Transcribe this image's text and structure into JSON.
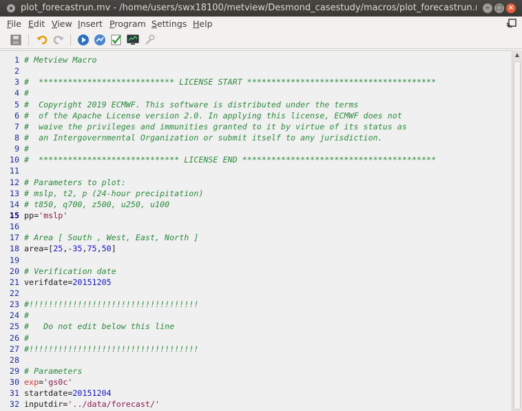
{
  "window": {
    "title": "plot_forecastrun.mv - /home/users/swx18100/metview/Desmond_casestudy/macros/plot_forecastrun.mv"
  },
  "menu": {
    "items": [
      {
        "mnemonic": "F",
        "rest": "ile"
      },
      {
        "mnemonic": "E",
        "rest": "dit"
      },
      {
        "mnemonic": "V",
        "rest": "iew"
      },
      {
        "mnemonic": "I",
        "rest": "nsert"
      },
      {
        "mnemonic": "P",
        "rest": "rogram"
      },
      {
        "mnemonic": "S",
        "rest": "ettings"
      },
      {
        "mnemonic": "H",
        "rest": "elp"
      }
    ]
  },
  "toolbar": {
    "icons": [
      "save-icon",
      "undo-icon",
      "redo-icon",
      "run-icon",
      "visualise-icon",
      "check-icon",
      "monitor-icon",
      "tools-icon"
    ]
  },
  "colors": {
    "comment": "#2b8a3c",
    "number": "#1313c0",
    "string": "#8a1a4a",
    "keyword": "#d03a3a",
    "line_number": "#1a2a9a"
  },
  "editor": {
    "current_line": 15,
    "lines": [
      {
        "n": "1",
        "tokens": [
          {
            "t": "# Metview Macro",
            "c": "comment"
          }
        ]
      },
      {
        "n": "2",
        "tokens": []
      },
      {
        "n": "3",
        "tokens": [
          {
            "t": "#  **************************** LICENSE START ***************************************",
            "c": "comment"
          }
        ]
      },
      {
        "n": "4",
        "tokens": [
          {
            "t": "#",
            "c": "comment"
          }
        ]
      },
      {
        "n": "5",
        "tokens": [
          {
            "t": "#  Copyright 2019 ECMWF. This software is distributed under the terms",
            "c": "comment"
          }
        ]
      },
      {
        "n": "6",
        "tokens": [
          {
            "t": "#  of the Apache License version 2.0. In applying this license, ECMWF does not",
            "c": "comment"
          }
        ]
      },
      {
        "n": "7",
        "tokens": [
          {
            "t": "#  waive the privileges and immunities granted to it by virtue of its status as",
            "c": "comment"
          }
        ]
      },
      {
        "n": "8",
        "tokens": [
          {
            "t": "#  an Intergovernmental Organization or submit itself to any jurisdiction.",
            "c": "comment"
          }
        ]
      },
      {
        "n": "9",
        "tokens": [
          {
            "t": "#",
            "c": "comment"
          }
        ]
      },
      {
        "n": "10",
        "tokens": [
          {
            "t": "#  ***************************** LICENSE END ****************************************",
            "c": "comment"
          }
        ]
      },
      {
        "n": "11",
        "tokens": []
      },
      {
        "n": "12",
        "tokens": [
          {
            "t": "# Parameters to plot:",
            "c": "comment"
          }
        ]
      },
      {
        "n": "13",
        "tokens": [
          {
            "t": "# mslp, t2, p (24-hour precipitation)",
            "c": "comment"
          }
        ]
      },
      {
        "n": "14",
        "tokens": [
          {
            "t": "# t850, q700, z500, u250, u100",
            "c": "comment"
          }
        ]
      },
      {
        "n": "15",
        "tokens": [
          {
            "t": "pp=",
            "c": "plain"
          },
          {
            "t": "'mslp'",
            "c": "string"
          }
        ]
      },
      {
        "n": "16",
        "tokens": []
      },
      {
        "n": "17",
        "tokens": [
          {
            "t": "# Area [ South , West, East, North ]",
            "c": "comment"
          }
        ]
      },
      {
        "n": "18",
        "tokens": [
          {
            "t": "area=[",
            "c": "plain"
          },
          {
            "t": "25",
            "c": "number"
          },
          {
            "t": ",-",
            "c": "plain"
          },
          {
            "t": "35",
            "c": "number"
          },
          {
            "t": ",",
            "c": "plain"
          },
          {
            "t": "75",
            "c": "number"
          },
          {
            "t": ",",
            "c": "plain"
          },
          {
            "t": "50",
            "c": "number"
          },
          {
            "t": "]",
            "c": "plain"
          }
        ]
      },
      {
        "n": "19",
        "tokens": []
      },
      {
        "n": "20",
        "tokens": [
          {
            "t": "# Verification date",
            "c": "comment"
          }
        ]
      },
      {
        "n": "21",
        "tokens": [
          {
            "t": "verifdate=",
            "c": "plain"
          },
          {
            "t": "20151205",
            "c": "number"
          }
        ]
      },
      {
        "n": "22",
        "tokens": []
      },
      {
        "n": "23",
        "tokens": [
          {
            "t": "#!!!!!!!!!!!!!!!!!!!!!!!!!!!!!!!!!!!",
            "c": "comment"
          }
        ]
      },
      {
        "n": "24",
        "tokens": [
          {
            "t": "#",
            "c": "comment"
          }
        ]
      },
      {
        "n": "25",
        "tokens": [
          {
            "t": "#   Do not edit below this line",
            "c": "comment"
          }
        ]
      },
      {
        "n": "26",
        "tokens": [
          {
            "t": "#",
            "c": "comment"
          }
        ]
      },
      {
        "n": "27",
        "tokens": [
          {
            "t": "#!!!!!!!!!!!!!!!!!!!!!!!!!!!!!!!!!!!",
            "c": "comment"
          }
        ]
      },
      {
        "n": "28",
        "tokens": []
      },
      {
        "n": "29",
        "tokens": [
          {
            "t": "# Parameters",
            "c": "comment"
          }
        ]
      },
      {
        "n": "30",
        "tokens": [
          {
            "t": "exp",
            "c": "kw"
          },
          {
            "t": "=",
            "c": "plain"
          },
          {
            "t": "'gs0c'",
            "c": "string"
          }
        ]
      },
      {
        "n": "31",
        "tokens": [
          {
            "t": "startdate=",
            "c": "plain"
          },
          {
            "t": "20151204",
            "c": "number"
          }
        ]
      },
      {
        "n": "32",
        "tokens": [
          {
            "t": "inputdir=",
            "c": "plain"
          },
          {
            "t": "'../data/forecast/'",
            "c": "string"
          }
        ]
      }
    ]
  }
}
